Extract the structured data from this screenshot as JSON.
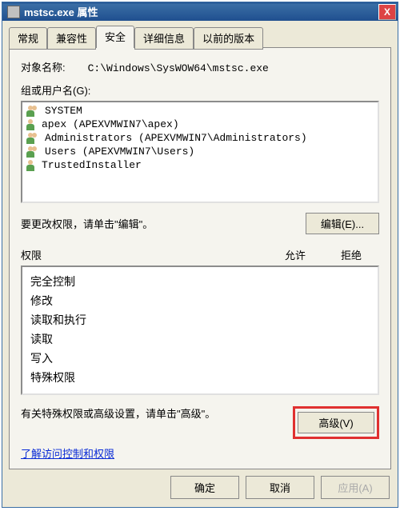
{
  "window": {
    "title": "mstsc.exe 属性",
    "close_label": "X"
  },
  "tabs": {
    "items": [
      "常规",
      "兼容性",
      "安全",
      "详细信息",
      "以前的版本"
    ],
    "active": 2
  },
  "object": {
    "label": "对象名称:",
    "path": "C:\\Windows\\SysWOW64\\mstsc.exe"
  },
  "groups": {
    "label": "组或用户名(G):",
    "items": [
      {
        "name": "SYSTEM",
        "icon": "multi"
      },
      {
        "name": "apex (APEXVMWIN7\\apex)",
        "icon": "single"
      },
      {
        "name": "Administrators (APEXVMWIN7\\Administrators)",
        "icon": "multi"
      },
      {
        "name": "Users (APEXVMWIN7\\Users)",
        "icon": "multi"
      },
      {
        "name": "TrustedInstaller",
        "icon": "single"
      }
    ]
  },
  "edit": {
    "text": "要更改权限，请单击\"编辑\"。",
    "button": "编辑(E)..."
  },
  "permissions": {
    "header_col1": "权限",
    "header_col2": "允许",
    "header_col3": "拒绝",
    "items": [
      "完全控制",
      "修改",
      "读取和执行",
      "读取",
      "写入",
      "特殊权限"
    ]
  },
  "advanced": {
    "text": "有关特殊权限或高级设置，请单击\"高级\"。",
    "button": "高级(V)"
  },
  "link": {
    "text": "了解访问控制和权限"
  },
  "footer": {
    "ok": "确定",
    "cancel": "取消",
    "apply": "应用(A)"
  }
}
